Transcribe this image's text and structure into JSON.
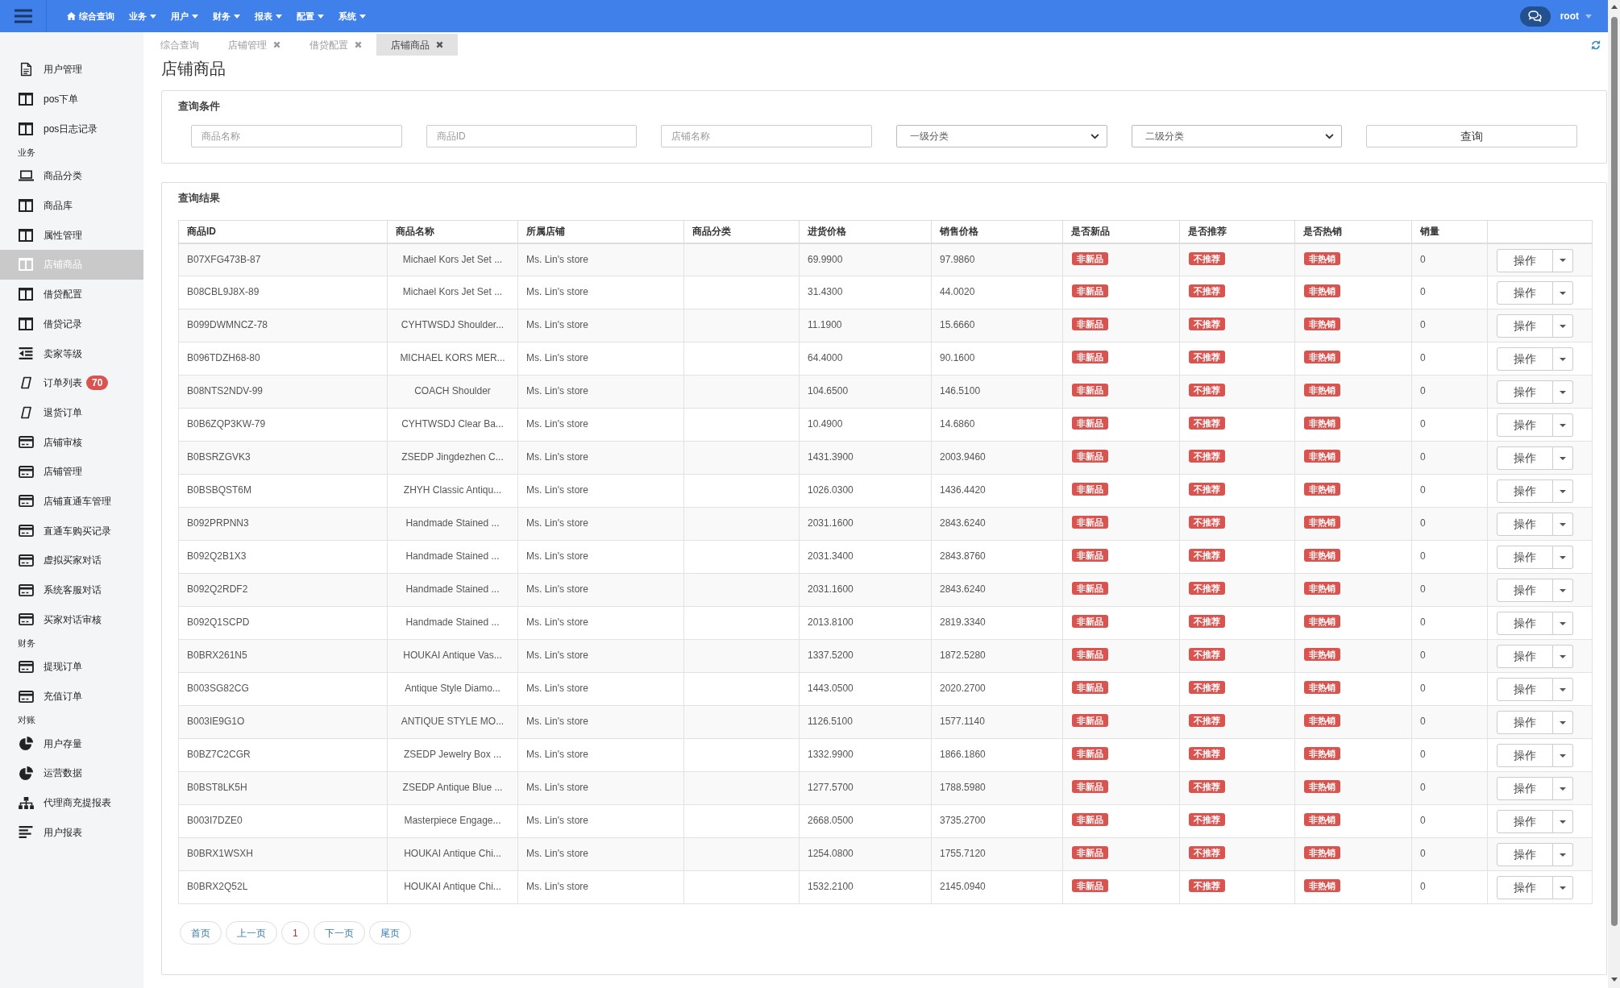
{
  "topbar": {
    "menu": [
      {
        "kind": "home",
        "label": "综合查询"
      },
      {
        "kind": "dropdown",
        "label": "业务"
      },
      {
        "kind": "dropdown",
        "label": "用户"
      },
      {
        "kind": "dropdown",
        "label": "财务"
      },
      {
        "kind": "dropdown",
        "label": "报表"
      },
      {
        "kind": "dropdown",
        "label": "配置"
      },
      {
        "kind": "dropdown",
        "label": "系统"
      }
    ],
    "user": "root"
  },
  "sidebar": {
    "groups": [
      {
        "items": [
          {
            "kind": "document",
            "label": "用户管理",
            "selected": false
          },
          {
            "kind": "columns",
            "label": "pos下单",
            "selected": false
          },
          {
            "kind": "columns",
            "label": "pos日志记录",
            "selected": false
          }
        ]
      },
      {
        "heading": "业务",
        "items": [
          {
            "kind": "laptop",
            "label": "商品分类",
            "selected": false
          },
          {
            "kind": "columns",
            "label": "商品库",
            "selected": false
          },
          {
            "kind": "columns",
            "label": "属性管理",
            "selected": false
          },
          {
            "kind": "columns",
            "label": "店铺商品",
            "selected": true
          },
          {
            "kind": "columns",
            "label": "借贷配置",
            "selected": false
          },
          {
            "kind": "columns",
            "label": "借贷记录",
            "selected": false
          },
          {
            "kind": "outdent",
            "label": "卖家等级",
            "selected": false
          },
          {
            "kind": "parallelogram",
            "label": "订单列表",
            "badge": "70",
            "selected": false
          },
          {
            "kind": "parallelogram",
            "label": "退货订单",
            "selected": false
          },
          {
            "kind": "card",
            "label": "店铺审核",
            "selected": false
          },
          {
            "kind": "card",
            "label": "店铺管理",
            "selected": false
          },
          {
            "kind": "card",
            "label": "店铺直通车管理",
            "selected": false
          },
          {
            "kind": "card",
            "label": "直通车购买记录",
            "selected": false
          },
          {
            "kind": "card",
            "label": "虚拟买家对话",
            "selected": false
          },
          {
            "kind": "card",
            "label": "系统客服对话",
            "selected": false
          },
          {
            "kind": "card",
            "label": "买家对话审核",
            "selected": false
          }
        ]
      },
      {
        "heading": "财务",
        "items": [
          {
            "kind": "card",
            "label": "提现订单",
            "selected": false
          },
          {
            "kind": "card",
            "label": "充值订单",
            "selected": false
          }
        ]
      },
      {
        "heading": "对账",
        "items": [
          {
            "kind": "pie",
            "label": "用户存量",
            "selected": false
          },
          {
            "kind": "pie",
            "label": "运营数据",
            "selected": false
          },
          {
            "kind": "sitemap",
            "label": "代理商充提报表",
            "selected": false
          },
          {
            "kind": "lines",
            "label": "用户报表",
            "selected": false
          }
        ]
      }
    ]
  },
  "tabs": [
    {
      "label": "综合查询",
      "closable": false,
      "selected": false
    },
    {
      "label": "店铺管理",
      "closable": true,
      "selected": false
    },
    {
      "label": "借贷配置",
      "closable": true,
      "selected": false
    },
    {
      "label": "店铺商品",
      "closable": true,
      "selected": true
    }
  ],
  "page_title": "店铺商品",
  "query": {
    "title": "查询条件",
    "fields": [
      {
        "kind": "input",
        "placeholder": "商品名称"
      },
      {
        "kind": "input",
        "placeholder": "商品ID"
      },
      {
        "kind": "input",
        "placeholder": "店铺名称"
      },
      {
        "kind": "select",
        "value": "一级分类"
      },
      {
        "kind": "select",
        "value": "二级分类"
      }
    ],
    "button": "查询"
  },
  "results": {
    "title": "查询结果",
    "table": {
      "columns": [
        "商品ID",
        "商品名称",
        "所属店铺",
        "商品分类",
        "进货价格",
        "销售价格",
        "是否新品",
        "是否推荐",
        "是否热销",
        "销量"
      ],
      "rows": [
        {
          "id": "B07XFG473B-87",
          "name": "Michael Kors Jet Set ...",
          "store": "Ms. Lin's store",
          "cost_price": "69.9900",
          "sale_price": "97.9860",
          "new": "非新品",
          "recommended": "不推荐",
          "hot": "非热销",
          "sales": "0",
          "action": "操作"
        },
        {
          "id": "B08CBL9J8X-89",
          "name": "Michael Kors Jet Set ...",
          "store": "Ms. Lin's store",
          "cost_price": "31.4300",
          "sale_price": "44.0020",
          "new": "非新品",
          "recommended": "不推荐",
          "hot": "非热销",
          "sales": "0",
          "action": "操作"
        },
        {
          "id": "B099DWMNCZ-78",
          "name": "CYHTWSDJ Shoulder...",
          "store": "Ms. Lin's store",
          "cost_price": "11.1900",
          "sale_price": "15.6660",
          "new": "非新品",
          "recommended": "不推荐",
          "hot": "非热销",
          "sales": "0",
          "action": "操作"
        },
        {
          "id": "B096TDZH68-80",
          "name": "MICHAEL KORS MER...",
          "store": "Ms. Lin's store",
          "cost_price": "64.4000",
          "sale_price": "90.1600",
          "new": "非新品",
          "recommended": "不推荐",
          "hot": "非热销",
          "sales": "0",
          "action": "操作"
        },
        {
          "id": "B08NTS2NDV-99",
          "name": "COACH Shoulder",
          "store": "Ms. Lin's store",
          "cost_price": "104.6500",
          "sale_price": "146.5100",
          "new": "非新品",
          "recommended": "不推荐",
          "hot": "非热销",
          "sales": "0",
          "action": "操作"
        },
        {
          "id": "B0B6ZQP3KW-79",
          "name": "CYHTWSDJ Clear Ba...",
          "store": "Ms. Lin's store",
          "cost_price": "10.4900",
          "sale_price": "14.6860",
          "new": "非新品",
          "recommended": "不推荐",
          "hot": "非热销",
          "sales": "0",
          "action": "操作"
        },
        {
          "id": "B0BSRZGVK3",
          "name": "ZSEDP Jingdezhen C...",
          "store": "Ms. Lin's store",
          "cost_price": "1431.3900",
          "sale_price": "2003.9460",
          "new": "非新品",
          "recommended": "不推荐",
          "hot": "非热销",
          "sales": "0",
          "action": "操作"
        },
        {
          "id": "B0BSBQST6M",
          "name": "ZHYH Classic Antiqu...",
          "store": "Ms. Lin's store",
          "cost_price": "1026.0300",
          "sale_price": "1436.4420",
          "new": "非新品",
          "recommended": "不推荐",
          "hot": "非热销",
          "sales": "0",
          "action": "操作"
        },
        {
          "id": "B092PRPNN3",
          "name": "Handmade Stained ...",
          "store": "Ms. Lin's store",
          "cost_price": "2031.1600",
          "sale_price": "2843.6240",
          "new": "非新品",
          "recommended": "不推荐",
          "hot": "非热销",
          "sales": "0",
          "action": "操作"
        },
        {
          "id": "B092Q2B1X3",
          "name": "Handmade Stained ...",
          "store": "Ms. Lin's store",
          "cost_price": "2031.3400",
          "sale_price": "2843.8760",
          "new": "非新品",
          "recommended": "不推荐",
          "hot": "非热销",
          "sales": "0",
          "action": "操作"
        },
        {
          "id": "B092Q2RDF2",
          "name": "Handmade Stained ...",
          "store": "Ms. Lin's store",
          "cost_price": "2031.1600",
          "sale_price": "2843.6240",
          "new": "非新品",
          "recommended": "不推荐",
          "hot": "非热销",
          "sales": "0",
          "action": "操作"
        },
        {
          "id": "B092Q1SCPD",
          "name": "Handmade Stained ...",
          "store": "Ms. Lin's store",
          "cost_price": "2013.8100",
          "sale_price": "2819.3340",
          "new": "非新品",
          "recommended": "不推荐",
          "hot": "非热销",
          "sales": "0",
          "action": "操作"
        },
        {
          "id": "B0BRX261N5",
          "name": "HOUKAI Antique Vas...",
          "store": "Ms. Lin's store",
          "cost_price": "1337.5200",
          "sale_price": "1872.5280",
          "new": "非新品",
          "recommended": "不推荐",
          "hot": "非热销",
          "sales": "0",
          "action": "操作"
        },
        {
          "id": "B003SG82CG",
          "name": "Antique Style Diamo...",
          "store": "Ms. Lin's store",
          "cost_price": "1443.0500",
          "sale_price": "2020.2700",
          "new": "非新品",
          "recommended": "不推荐",
          "hot": "非热销",
          "sales": "0",
          "action": "操作"
        },
        {
          "id": "B003IE9G1O",
          "name": "ANTIQUE STYLE MO...",
          "store": "Ms. Lin's store",
          "cost_price": "1126.5100",
          "sale_price": "1577.1140",
          "new": "非新品",
          "recommended": "不推荐",
          "hot": "非热销",
          "sales": "0",
          "action": "操作"
        },
        {
          "id": "B0BZ7C2CGR",
          "name": "ZSEDP Jewelry Box ...",
          "store": "Ms. Lin's store",
          "cost_price": "1332.9900",
          "sale_price": "1866.1860",
          "new": "非新品",
          "recommended": "不推荐",
          "hot": "非热销",
          "sales": "0",
          "action": "操作"
        },
        {
          "id": "B0BST8LK5H",
          "name": "ZSEDP Antique Blue ...",
          "store": "Ms. Lin's store",
          "cost_price": "1277.5700",
          "sale_price": "1788.5980",
          "new": "非新品",
          "recommended": "不推荐",
          "hot": "非热销",
          "sales": "0",
          "action": "操作"
        },
        {
          "id": "B003I7DZE0",
          "name": "Masterpiece Engage...",
          "store": "Ms. Lin's store",
          "cost_price": "2668.0500",
          "sale_price": "3735.2700",
          "new": "非新品",
          "recommended": "不推荐",
          "hot": "非热销",
          "sales": "0",
          "action": "操作"
        },
        {
          "id": "B0BRX1WSXH",
          "name": "HOUKAI Antique Chi...",
          "store": "Ms. Lin's store",
          "cost_price": "1254.0800",
          "sale_price": "1755.7120",
          "new": "非新品",
          "recommended": "不推荐",
          "hot": "非热销",
          "sales": "0",
          "action": "操作"
        },
        {
          "id": "B0BRX2Q52L",
          "name": "HOUKAI Antique Chi...",
          "store": "Ms. Lin's store",
          "cost_price": "1532.2100",
          "sale_price": "2145.0940",
          "new": "非新品",
          "recommended": "不推荐",
          "hot": "非热销",
          "sales": "0",
          "action": "操作"
        }
      ]
    }
  },
  "pagination": [
    {
      "label": "首页",
      "selected": false
    },
    {
      "label": "上一页",
      "selected": false
    },
    {
      "label": "1",
      "selected": true
    },
    {
      "label": "下一页",
      "selected": false
    },
    {
      "label": "尾页",
      "selected": false
    }
  ]
}
